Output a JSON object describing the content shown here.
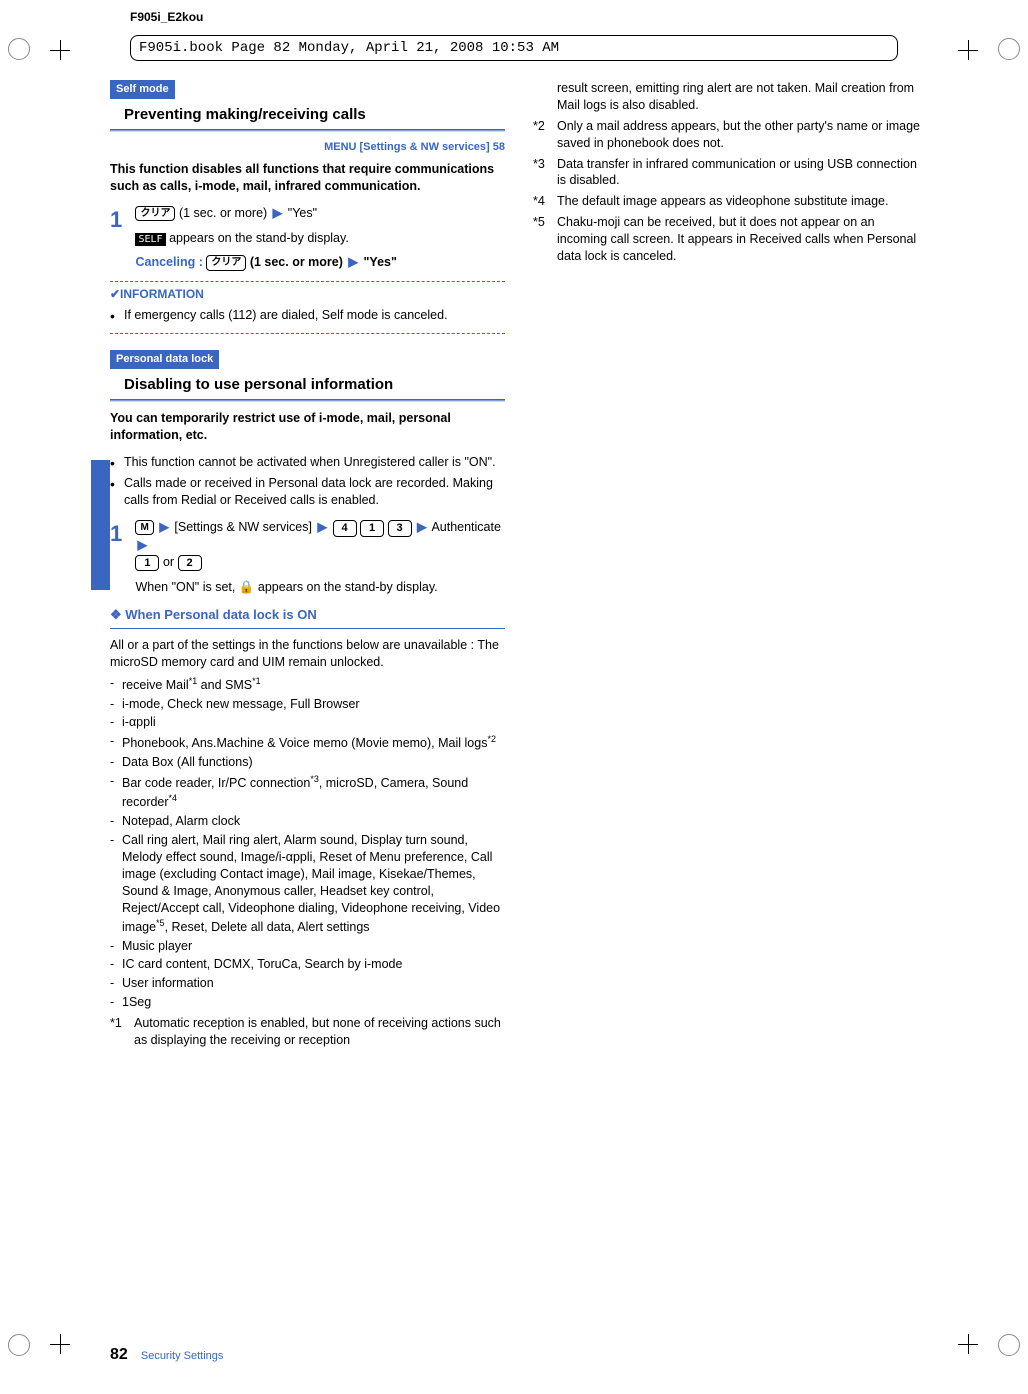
{
  "meta": {
    "model": "F905i_E2kou",
    "book_info": "F905i.book  Page 82  Monday, April 21, 2008  10:53 AM"
  },
  "left": {
    "tag1": "Self mode",
    "title1": "Preventing making/receiving calls",
    "menu_path": "MENU [Settings & NW services] 58",
    "intro1": "This function disables all functions that require communications such as calls, i-mode, mail, infrared communication.",
    "step1_num": "1",
    "step1_key": "クリア",
    "step1_text_a": " (1 sec. or more)",
    "step1_text_b": "\"Yes\"",
    "self_icon": "SELF",
    "step1_note": " appears on the stand-by display.",
    "cancel_label": "Canceling : ",
    "cancel_key": "クリア",
    "cancel_text_a": "(1 sec. or more)",
    "cancel_text_b": "\"Yes\"",
    "info_label": "✔INFORMATION",
    "info_bullet": "If emergency calls (112) are dialed, Self mode is canceled.",
    "tag2": "Personal data lock",
    "title2": "Disabling to use personal information",
    "intro2": "You can temporarily restrict use of i-mode, mail, personal information, etc.",
    "pdl_bullets": [
      "This function cannot be activated when Unregistered caller is \"ON\".",
      "Calls made or received in Personal data lock are recorded. Making calls from Redial or Received calls is enabled."
    ],
    "step2_num": "1",
    "step2_key_menu": "M",
    "step2_text_a": "[Settings & NW services]",
    "step2_keys": [
      "4",
      "1",
      "3"
    ],
    "step2_auth": "Authenticate",
    "step2_or": " or ",
    "step2_choice": [
      "1",
      "2"
    ],
    "step2_note_a": "When \"ON\" is set, ",
    "step2_note_b": " appears on the stand-by display.",
    "lock_icon": "🔒",
    "diamond_head": "❖ When Personal data lock is ON",
    "body_after": "All or a part of the settings in the functions below are unavailable : The microSD memory card and UIM remain unlocked.",
    "dash_items": [
      "receive Mail*1 and SMS*1",
      "i-mode, Check new message, Full Browser",
      "i-αppli",
      "Phonebook, Ans.Machine & Voice memo (Movie memo), Mail logs*2",
      "Data Box (All functions)",
      "Bar code reader, Ir/PC connection*3, microSD, Camera, Sound recorder*4",
      " Notepad, Alarm clock",
      "Call ring alert, Mail ring alert, Alarm sound, Display turn sound, Melody effect sound, Image/i-αppli, Reset of Menu preference, Call image (excluding Contact image), Mail image, Kisekae/Themes, Sound & Image, Anonymous caller, Headset key control, Reject/Accept call, Videophone dialing, Videophone receiving, Video image*5, Reset, Delete all data, Alert settings",
      "Music player",
      "IC card content, DCMX, ToruCa, Search by i-mode",
      "User information",
      "1Seg"
    ],
    "fn1_label": "*1",
    "fn1_text": "Automatic reception is enabled, but none of receiving actions such as displaying the receiving or reception"
  },
  "right": {
    "continuation": "result screen, emitting ring alert are not taken. Mail creation from Mail logs is also disabled.",
    "footnotes": [
      {
        "n": "*2",
        "t": "Only a mail address appears, but the other party's name or image saved in phonebook does not."
      },
      {
        "n": "*3",
        "t": "Data transfer in infrared communication or using USB connection is disabled."
      },
      {
        "n": "*4",
        "t": "The default image appears as videophone substitute image."
      },
      {
        "n": "*5",
        "t": "Chaku-moji can be received, but it does not appear on an incoming call screen. It appears in Received calls when Personal data lock is canceled."
      }
    ]
  },
  "footer": {
    "page": "82",
    "section": "Security Settings"
  }
}
